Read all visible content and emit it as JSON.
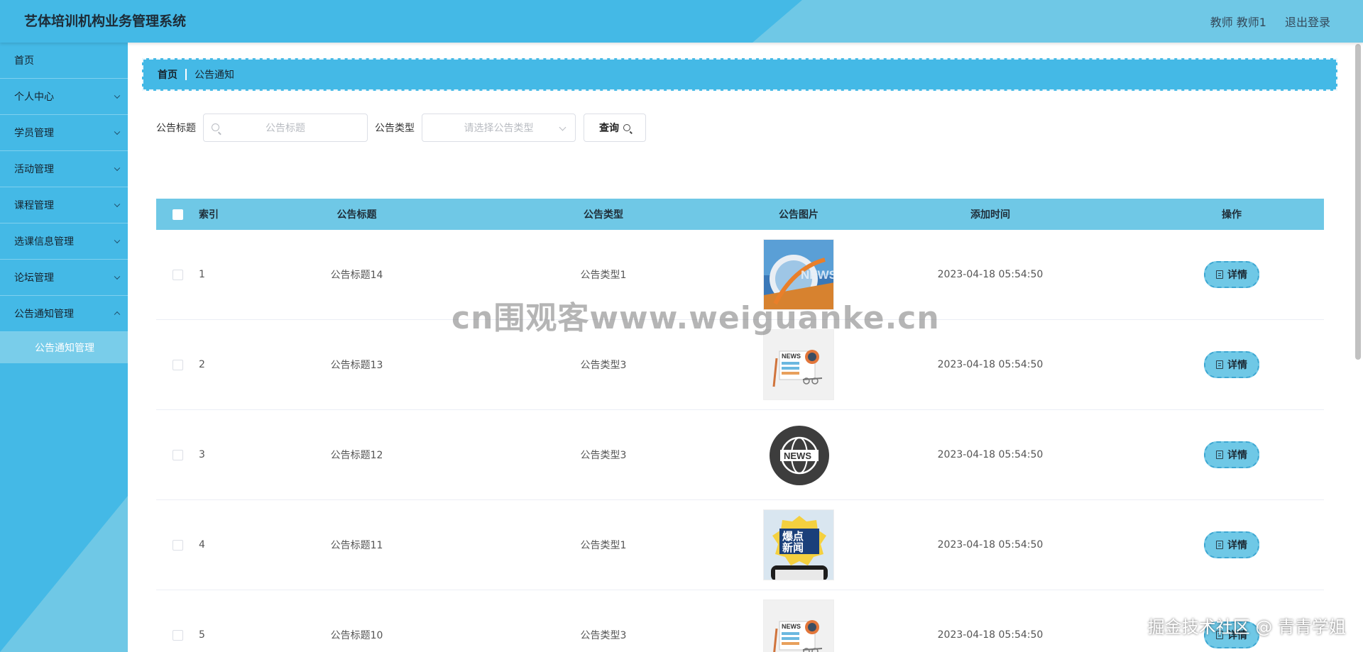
{
  "header": {
    "title": "艺体培训机构业务管理系统",
    "user": "教师 教师1",
    "logout": "退出登录"
  },
  "sidebar": {
    "items": [
      {
        "label": "首页",
        "has_children": false
      },
      {
        "label": "个人中心",
        "has_children": true
      },
      {
        "label": "学员管理",
        "has_children": true
      },
      {
        "label": "活动管理",
        "has_children": true
      },
      {
        "label": "课程管理",
        "has_children": true
      },
      {
        "label": "选课信息管理",
        "has_children": true
      },
      {
        "label": "论坛管理",
        "has_children": true
      },
      {
        "label": "公告通知管理",
        "has_children": true,
        "open": true
      }
    ],
    "sub_item": "公告通知管理"
  },
  "breadcrumb": {
    "home": "首页",
    "current": "公告通知"
  },
  "search": {
    "title_label": "公告标题",
    "title_placeholder": "公告标题",
    "type_label": "公告类型",
    "type_placeholder": "请选择公告类型",
    "query_button": "查询"
  },
  "table": {
    "headers": {
      "index": "索引",
      "title": "公告标题",
      "type": "公告类型",
      "picture": "公告图片",
      "time": "添加时间",
      "action": "操作"
    },
    "detail_label": "详情",
    "rows": [
      {
        "index": "1",
        "title": "公告标题14",
        "type": "公告类型1",
        "time": "2023-04-18 05:54:50",
        "image": "news-globe"
      },
      {
        "index": "2",
        "title": "公告标题13",
        "type": "公告类型3",
        "time": "2023-04-18 05:54:50",
        "image": "news-paper"
      },
      {
        "index": "3",
        "title": "公告标题12",
        "type": "公告类型3",
        "time": "2023-04-18 05:54:50",
        "image": "news-badge"
      },
      {
        "index": "4",
        "title": "公告标题11",
        "type": "公告类型1",
        "time": "2023-04-18 05:54:50",
        "image": "hot-news"
      },
      {
        "index": "5",
        "title": "公告标题10",
        "type": "公告类型3",
        "time": "2023-04-18 05:54:50",
        "image": "news-paper"
      }
    ]
  },
  "watermark": {
    "center": "cn围观客www.weiguanke.cn",
    "corner": "掘金技术社区 @ 青青学姐"
  },
  "colors": {
    "primary": "#44b9e6",
    "light": "#6fc8e6",
    "submenu": "#79cdea"
  }
}
